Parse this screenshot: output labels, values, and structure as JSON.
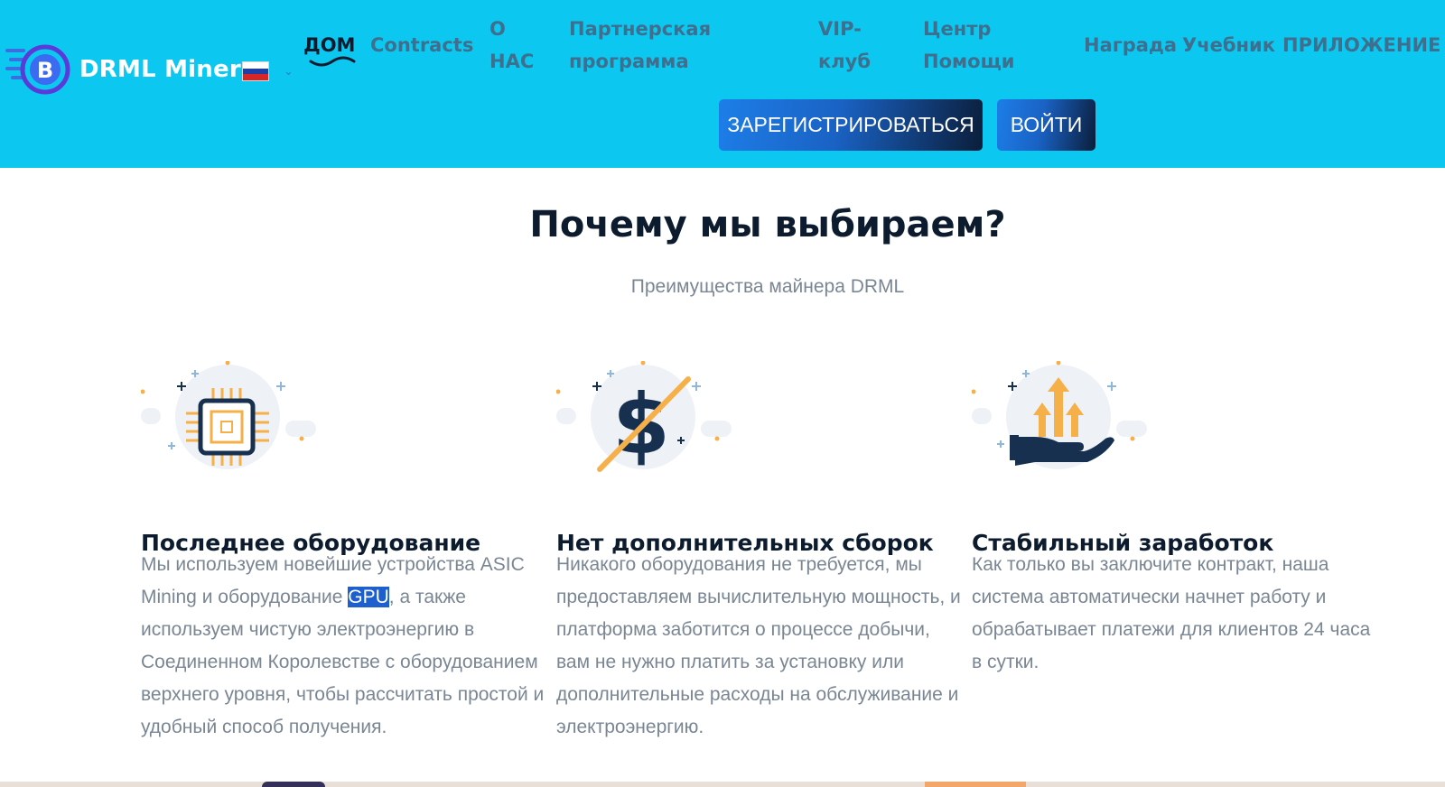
{
  "header": {
    "brand": "DRML Miner",
    "language": "ru",
    "nav": [
      {
        "label": "ДОМ"
      },
      {
        "label": "Contracts"
      },
      {
        "label": "О\nНАС"
      },
      {
        "label": "Партнерская\nпрограмма"
      },
      {
        "label": "VIP-\nклуб"
      },
      {
        "label": "Центр\nПомощи"
      },
      {
        "label": "Награда"
      },
      {
        "label": "Учебник"
      },
      {
        "label": "ПРИЛОЖЕНИЕ"
      }
    ],
    "register_label": "ЗАРЕГИСТРИРОВАТЬСЯ",
    "login_label": "ВОЙТИ"
  },
  "section": {
    "title": "Почему мы выбираем?",
    "subtitle": "Преимущества майнера DRML"
  },
  "features": [
    {
      "icon": "chip-icon",
      "title": "Последнее оборудование",
      "text_before": "Мы используем новейшие устройства ASIC Mining и оборудование ",
      "highlight": "GPU",
      "text_after": ", а также используем чистую электроэнергию в Соединенном Королевстве с оборудованием верхнего уровня, чтобы рассчитать простой и удобный способ получения."
    },
    {
      "icon": "no-dollar-icon",
      "title": "Нет дополнительных сборок",
      "text": "Никакого оборудования не требуется, мы предоставляем вычислительную мощность, и платформа заботится о процессе добычи, вам не нужно платить за установку или дополнительные расходы на обслуживание и электроэнергию."
    },
    {
      "icon": "hand-growth-icon",
      "title": "Стабильный заработок",
      "text": "Как только вы заключите контракт, наша система автоматически начнет работу и обрабатывает платежи для клиентов 24 часа в сутки."
    }
  ],
  "colors": {
    "header_bg": "#0cc8f0",
    "nav_text": "#3f6f8f",
    "nav_active": "#0d1b2e",
    "accent_orange": "#f6b04a",
    "icon_navy": "#17304f"
  }
}
